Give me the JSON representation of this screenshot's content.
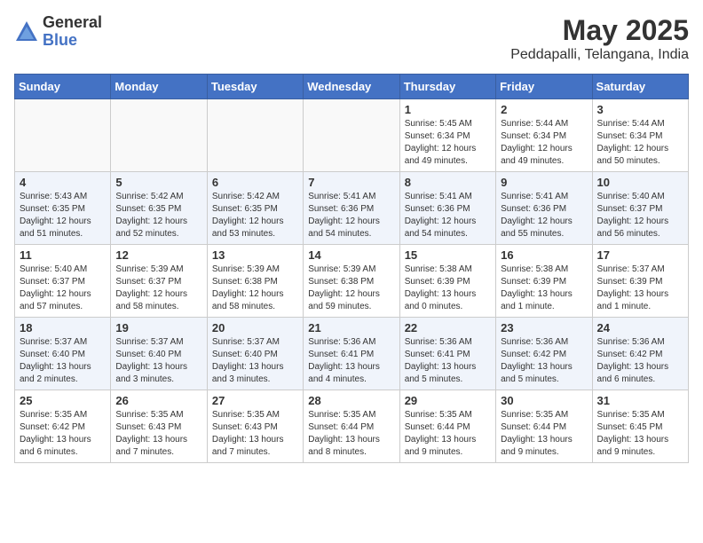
{
  "logo": {
    "general": "General",
    "blue": "Blue"
  },
  "title": "May 2025",
  "subtitle": "Peddapalli, Telangana, India",
  "weekdays": [
    "Sunday",
    "Monday",
    "Tuesday",
    "Wednesday",
    "Thursday",
    "Friday",
    "Saturday"
  ],
  "weeks": [
    [
      {
        "day": "",
        "info": ""
      },
      {
        "day": "",
        "info": ""
      },
      {
        "day": "",
        "info": ""
      },
      {
        "day": "",
        "info": ""
      },
      {
        "day": "1",
        "info": "Sunrise: 5:45 AM\nSunset: 6:34 PM\nDaylight: 12 hours\nand 49 minutes."
      },
      {
        "day": "2",
        "info": "Sunrise: 5:44 AM\nSunset: 6:34 PM\nDaylight: 12 hours\nand 49 minutes."
      },
      {
        "day": "3",
        "info": "Sunrise: 5:44 AM\nSunset: 6:34 PM\nDaylight: 12 hours\nand 50 minutes."
      }
    ],
    [
      {
        "day": "4",
        "info": "Sunrise: 5:43 AM\nSunset: 6:35 PM\nDaylight: 12 hours\nand 51 minutes."
      },
      {
        "day": "5",
        "info": "Sunrise: 5:42 AM\nSunset: 6:35 PM\nDaylight: 12 hours\nand 52 minutes."
      },
      {
        "day": "6",
        "info": "Sunrise: 5:42 AM\nSunset: 6:35 PM\nDaylight: 12 hours\nand 53 minutes."
      },
      {
        "day": "7",
        "info": "Sunrise: 5:41 AM\nSunset: 6:36 PM\nDaylight: 12 hours\nand 54 minutes."
      },
      {
        "day": "8",
        "info": "Sunrise: 5:41 AM\nSunset: 6:36 PM\nDaylight: 12 hours\nand 54 minutes."
      },
      {
        "day": "9",
        "info": "Sunrise: 5:41 AM\nSunset: 6:36 PM\nDaylight: 12 hours\nand 55 minutes."
      },
      {
        "day": "10",
        "info": "Sunrise: 5:40 AM\nSunset: 6:37 PM\nDaylight: 12 hours\nand 56 minutes."
      }
    ],
    [
      {
        "day": "11",
        "info": "Sunrise: 5:40 AM\nSunset: 6:37 PM\nDaylight: 12 hours\nand 57 minutes."
      },
      {
        "day": "12",
        "info": "Sunrise: 5:39 AM\nSunset: 6:37 PM\nDaylight: 12 hours\nand 58 minutes."
      },
      {
        "day": "13",
        "info": "Sunrise: 5:39 AM\nSunset: 6:38 PM\nDaylight: 12 hours\nand 58 minutes."
      },
      {
        "day": "14",
        "info": "Sunrise: 5:39 AM\nSunset: 6:38 PM\nDaylight: 12 hours\nand 59 minutes."
      },
      {
        "day": "15",
        "info": "Sunrise: 5:38 AM\nSunset: 6:39 PM\nDaylight: 13 hours\nand 0 minutes."
      },
      {
        "day": "16",
        "info": "Sunrise: 5:38 AM\nSunset: 6:39 PM\nDaylight: 13 hours\nand 1 minute."
      },
      {
        "day": "17",
        "info": "Sunrise: 5:37 AM\nSunset: 6:39 PM\nDaylight: 13 hours\nand 1 minute."
      }
    ],
    [
      {
        "day": "18",
        "info": "Sunrise: 5:37 AM\nSunset: 6:40 PM\nDaylight: 13 hours\nand 2 minutes."
      },
      {
        "day": "19",
        "info": "Sunrise: 5:37 AM\nSunset: 6:40 PM\nDaylight: 13 hours\nand 3 minutes."
      },
      {
        "day": "20",
        "info": "Sunrise: 5:37 AM\nSunset: 6:40 PM\nDaylight: 13 hours\nand 3 minutes."
      },
      {
        "day": "21",
        "info": "Sunrise: 5:36 AM\nSunset: 6:41 PM\nDaylight: 13 hours\nand 4 minutes."
      },
      {
        "day": "22",
        "info": "Sunrise: 5:36 AM\nSunset: 6:41 PM\nDaylight: 13 hours\nand 5 minutes."
      },
      {
        "day": "23",
        "info": "Sunrise: 5:36 AM\nSunset: 6:42 PM\nDaylight: 13 hours\nand 5 minutes."
      },
      {
        "day": "24",
        "info": "Sunrise: 5:36 AM\nSunset: 6:42 PM\nDaylight: 13 hours\nand 6 minutes."
      }
    ],
    [
      {
        "day": "25",
        "info": "Sunrise: 5:35 AM\nSunset: 6:42 PM\nDaylight: 13 hours\nand 6 minutes."
      },
      {
        "day": "26",
        "info": "Sunrise: 5:35 AM\nSunset: 6:43 PM\nDaylight: 13 hours\nand 7 minutes."
      },
      {
        "day": "27",
        "info": "Sunrise: 5:35 AM\nSunset: 6:43 PM\nDaylight: 13 hours\nand 7 minutes."
      },
      {
        "day": "28",
        "info": "Sunrise: 5:35 AM\nSunset: 6:44 PM\nDaylight: 13 hours\nand 8 minutes."
      },
      {
        "day": "29",
        "info": "Sunrise: 5:35 AM\nSunset: 6:44 PM\nDaylight: 13 hours\nand 9 minutes."
      },
      {
        "day": "30",
        "info": "Sunrise: 5:35 AM\nSunset: 6:44 PM\nDaylight: 13 hours\nand 9 minutes."
      },
      {
        "day": "31",
        "info": "Sunrise: 5:35 AM\nSunset: 6:45 PM\nDaylight: 13 hours\nand 9 minutes."
      }
    ]
  ]
}
